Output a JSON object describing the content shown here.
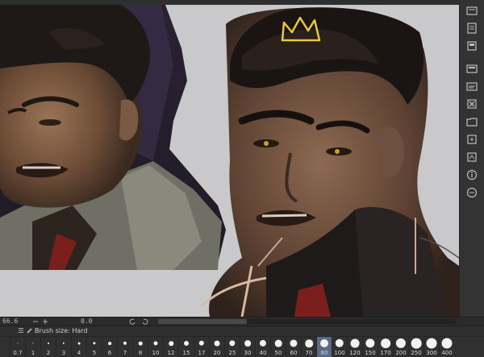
{
  "status_bar": {
    "zoom": "66.6",
    "angle": "0.0"
  },
  "brush_palette": {
    "title": "Brush size: Hard",
    "selected": "80",
    "sizes": [
      "0.7",
      "1",
      "2",
      "3",
      "4",
      "5",
      "6",
      "7",
      "8",
      "10",
      "12",
      "15",
      "17",
      "20",
      "25",
      "30",
      "40",
      "50",
      "60",
      "70",
      "80",
      "100",
      "120",
      "150",
      "170",
      "200",
      "250",
      "300",
      "400"
    ]
  },
  "icons": {
    "canvas_crown": "crown-icon",
    "right_toolbar": [
      "layer-properties-icon",
      "layer-search-icon",
      "layer-icon",
      "folder-icon",
      "layer-duplicate-icon",
      "clear-layer-icon",
      "new-folder-icon",
      "layer-move-icon",
      "transfer-layer-icon",
      "info-icon",
      "navigator-icon"
    ]
  },
  "colors": {
    "canvas_background": "#c9c9cb",
    "selected_size": "#5a6b86",
    "crown_stroke": "#e8c840"
  }
}
